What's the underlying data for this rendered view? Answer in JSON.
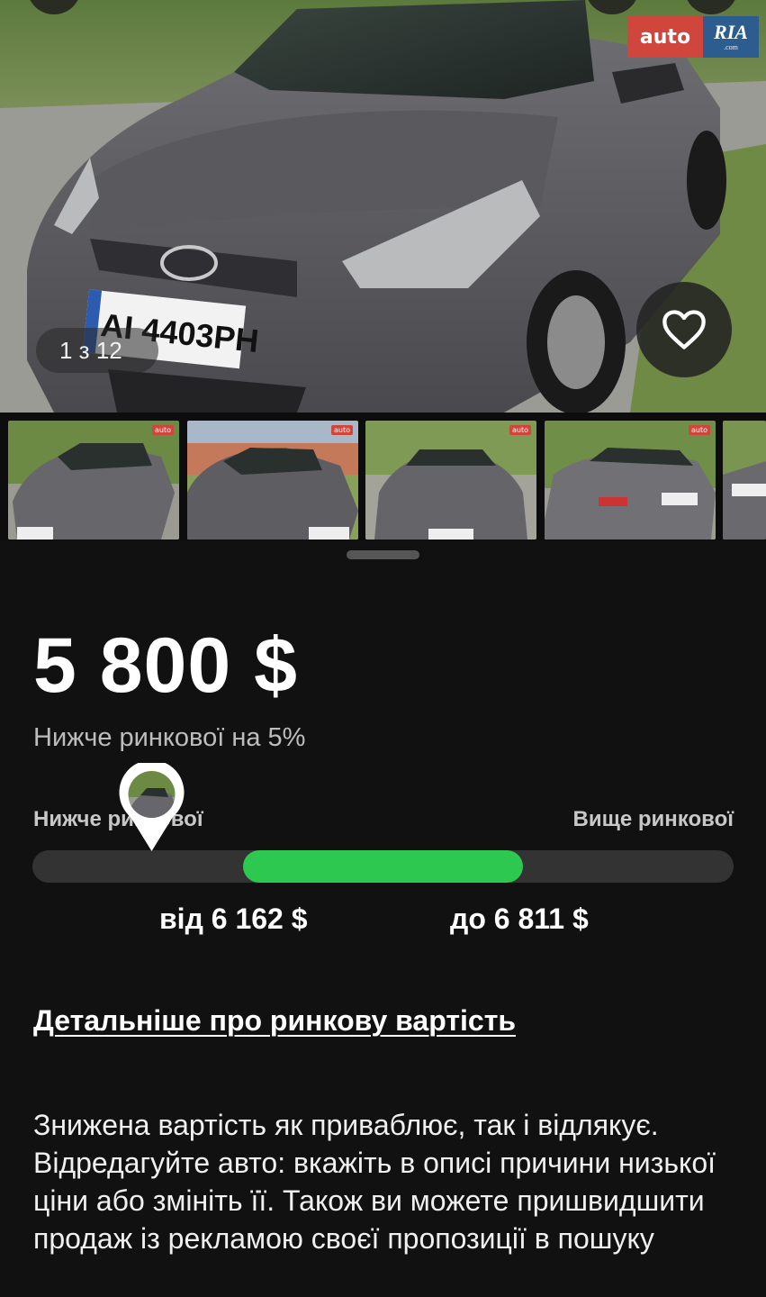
{
  "gallery": {
    "counter": "1 з 12",
    "logo": {
      "auto": "auto",
      "ria": "RIA",
      "ria_suffix": ".com"
    },
    "plate": "AI 4403PH",
    "thumb_tag": "auto"
  },
  "price": {
    "value": "5 800 $",
    "comparison": "Нижче ринкової на 5%"
  },
  "market_scale": {
    "left_label": "Нижче ринкової",
    "right_label": "Вище ринкової",
    "range_from": "від 6 162 $",
    "range_to": "до 6 811 $",
    "marker_position_fraction": 0.17,
    "range_start_fraction": 0.3,
    "range_end_fraction": 0.7,
    "accent_color": "#2cc84f"
  },
  "details_link": "Детальніше про ринкову вартість",
  "advice_text": "Знижена вартість як приваблює, так і відлякує. Відредагуйте авто: вкажіть в описі причини низької ціни або змініть її. Також ви можете пришвидшити продаж із рекламою своєї пропозиції в пошуку"
}
